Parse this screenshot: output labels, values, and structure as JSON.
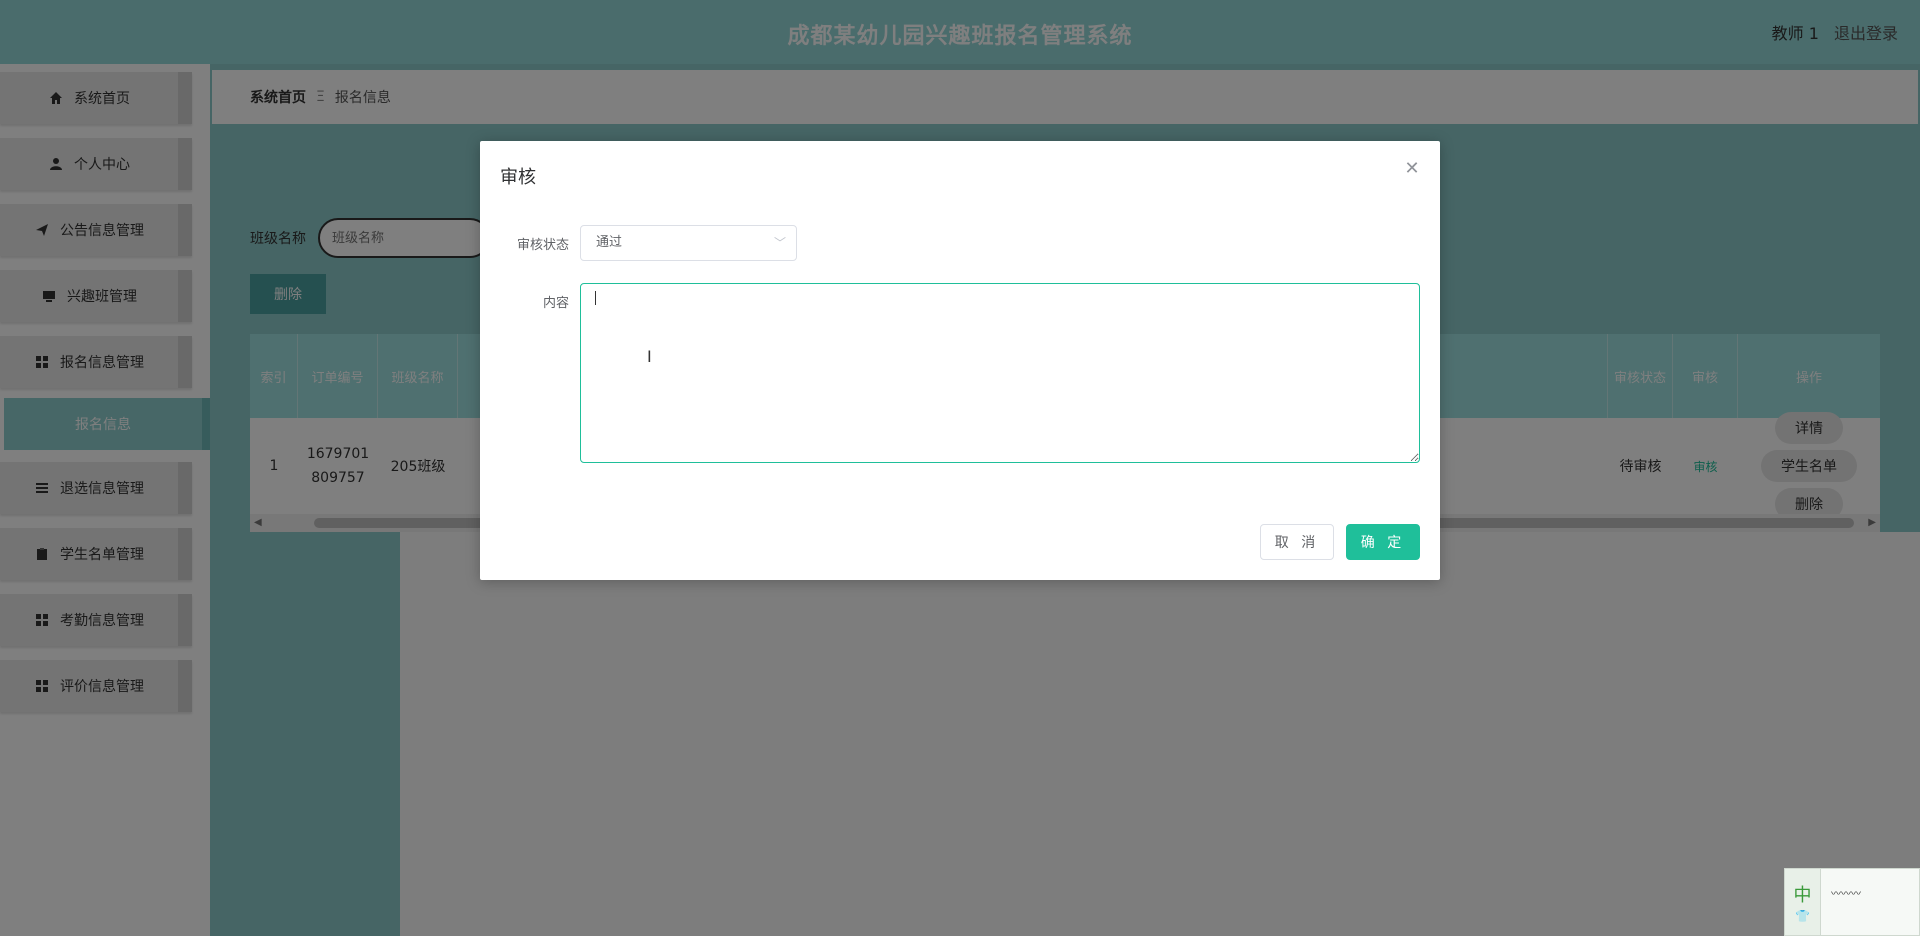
{
  "header": {
    "title": "成都某幼儿园兴趣班报名管理系统",
    "user": "教师 1",
    "logout": "退出登录"
  },
  "sidebar": {
    "items": [
      {
        "label": "系统首页",
        "icon": "home-icon"
      },
      {
        "label": "个人中心",
        "icon": "user-icon"
      },
      {
        "label": "公告信息管理",
        "icon": "send-icon"
      },
      {
        "label": "兴趣班管理",
        "icon": "monitor-icon"
      },
      {
        "label": "报名信息管理",
        "icon": "grid-icon"
      },
      {
        "label": "退选信息管理",
        "icon": "list-icon"
      },
      {
        "label": "学生名单管理",
        "icon": "clipboard-icon"
      },
      {
        "label": "考勤信息管理",
        "icon": "grid-icon"
      },
      {
        "label": "评价信息管理",
        "icon": "grid-icon"
      }
    ],
    "active_sub": "报名信息"
  },
  "breadcrumb": {
    "home": "系统首页",
    "separator": "Ξ",
    "current": "报名信息"
  },
  "search": {
    "label": "班级名称",
    "placeholder": "班级名称"
  },
  "toolbar": {
    "delete": "删除"
  },
  "table": {
    "headers": [
      "索引",
      "订单编号",
      "班级名称",
      "审核状态",
      "审核",
      "操作"
    ],
    "row": {
      "index": "1",
      "order_no": "1679701809757",
      "class_name": "205班级",
      "status": "待审核",
      "audit": "审核",
      "ops": [
        "详情",
        "学生名单",
        "删除"
      ]
    }
  },
  "modal": {
    "title": "审核",
    "status_label": "审核状态",
    "status_value": "通过",
    "content_label": "内容",
    "cancel": "取 消",
    "confirm": "确 定"
  },
  "ime": {
    "mode": "中"
  },
  "colors": {
    "header": "#94d8d8",
    "accent": "#1fbf9a",
    "table_header": "#9fe0e0"
  }
}
